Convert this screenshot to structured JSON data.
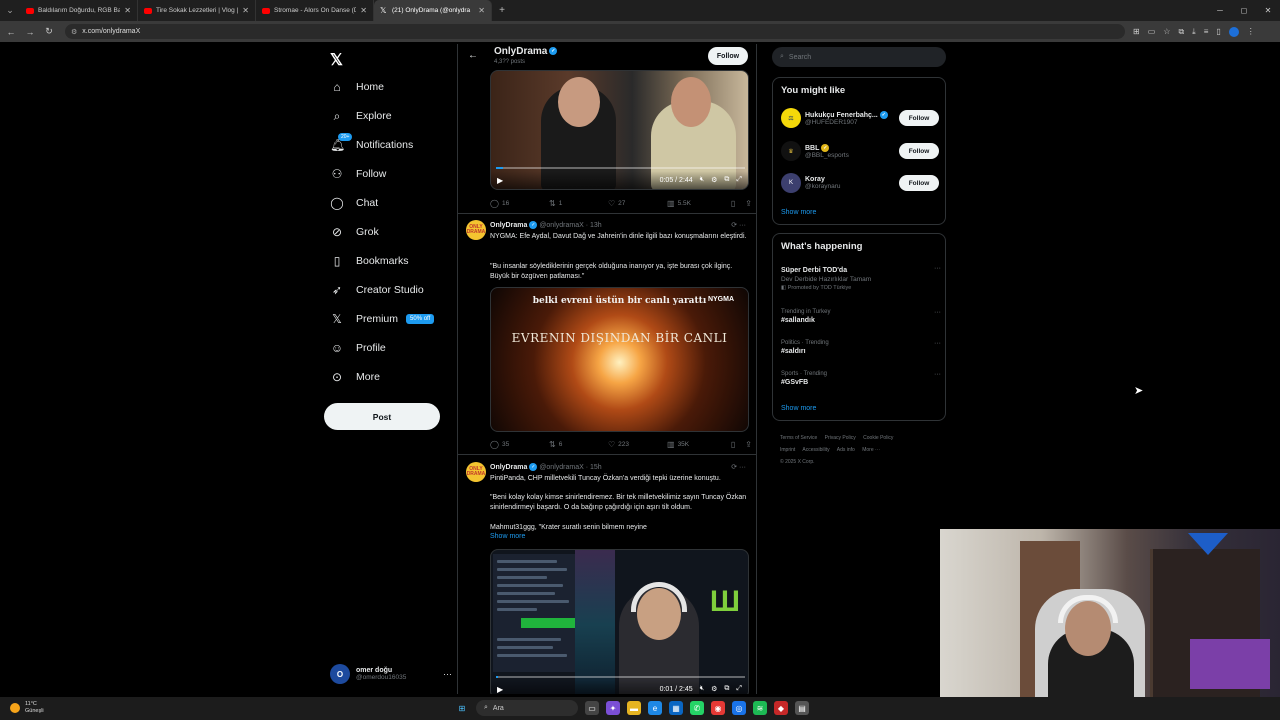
{
  "browser": {
    "tabs": [
      {
        "title": "Baldılarım Doğurdu, RGB Balkon",
        "icon": "youtube-icon",
        "active": false
      },
      {
        "title": "Tire Sokak Lezzetleri | Vlog | ",
        "icon": "youtube-icon",
        "active": false
      },
      {
        "title": "Stromae - Alors On Danse (Dul",
        "icon": "youtube-icon",
        "active": false
      },
      {
        "title": "(21) OnlyDrama (@onlydra",
        "icon": "x-icon",
        "active": true
      }
    ],
    "new_tab": "+",
    "url": "x.com/onlydramaX"
  },
  "nav": {
    "items": [
      {
        "label": "Home",
        "icon": "home-icon"
      },
      {
        "label": "Explore",
        "icon": "search-icon"
      },
      {
        "label": "Notifications",
        "icon": "bell-icon",
        "badge": "20+"
      },
      {
        "label": "Follow",
        "icon": "follow-icon"
      },
      {
        "label": "Chat",
        "icon": "chat-icon"
      },
      {
        "label": "Grok",
        "icon": "grok-icon"
      },
      {
        "label": "Bookmarks",
        "icon": "bookmark-icon"
      },
      {
        "label": "Creator Studio",
        "icon": "rocket-icon"
      },
      {
        "label": "Premium",
        "icon": "x-icon",
        "badge": "50% off"
      },
      {
        "label": "Profile",
        "icon": "user-icon"
      },
      {
        "label": "More",
        "icon": "more-circle-icon"
      }
    ],
    "post_label": "Post",
    "account": {
      "initial": "O",
      "name": "omer doğu",
      "handle": "@omerdou16035"
    }
  },
  "header": {
    "name": "OnlyDrama",
    "posts": "4,3?? posts",
    "follow_label": "Follow"
  },
  "tweets": [
    {
      "video": {
        "time": "0:05 / 2:44",
        "progress": 0.03
      },
      "stats": {
        "replies": "16",
        "reposts": "1",
        "likes": "27",
        "views": "5.5K"
      }
    },
    {
      "name": "OnlyDrama",
      "handle": "@onlydramaX",
      "time": "13h",
      "avatar_text": "ONLY DRAMA",
      "text": "NYGMA: Efe Aydal, Davut Dağ ve Jahrein'in dinle ilgili bazı konuşmalarını eleştirdi.",
      "text2": "\"Bu insanlar söylediklerinin gerçek olduğuna inanıyor ya, işte burası çok ilginç. Büyük bir özgüven patlaması.\"",
      "media": {
        "caption": "belki evreni üstün bir canlı yarattı",
        "logo": "NYGMA",
        "big": "EVRENIN DIŞINDAN BİR CANLI"
      },
      "stats": {
        "replies": "35",
        "reposts": "6",
        "likes": "223",
        "views": "35K"
      }
    },
    {
      "name": "OnlyDrama",
      "handle": "@onlydramaX",
      "time": "15h",
      "avatar_text": "ONLY DRAMA",
      "text": "PintiPanda, CHP milletvekili Tuncay Özkan'a verdiği tepki üzerine konuştu.",
      "text2": "\"Beni kolay kolay kimse sinirlendiremez. Bir tek milletvekilimiz sayın Tuncay Özkan sinirlendirmeyi başardı. O da bağırıp çağırdığı için aşırı tilt oldum.",
      "text3": "Mahmut31ggg, \"Krater suratlı senin bilmem neyine",
      "show_more": "Show more",
      "video": {
        "time": "0:01 / 2:45",
        "progress": 0.01
      }
    }
  ],
  "right": {
    "search_placeholder": "Search",
    "might_like_title": "You might like",
    "suggestions": [
      {
        "name": "Hukukçu Fenerbahç...",
        "handle": "@HUFEDER1907",
        "badge": "blue",
        "follow": "Follow"
      },
      {
        "name": "BBL",
        "handle": "@BBL_esports",
        "badge": "gold",
        "follow": "Follow"
      },
      {
        "name": "Koray",
        "handle": "@koraynaru",
        "badge": "",
        "follow": "Follow"
      }
    ],
    "show_more": "Show more",
    "happening_title": "What's happening",
    "trends": [
      {
        "meta": "",
        "title": "Süper Derbi TOD'da",
        "desc": "Dev Derbide Hazırlıklar Tamam",
        "promo": "Promoted by TOD Türkiye"
      },
      {
        "meta": "Trending in Turkey",
        "title": "#sallandık",
        "desc": "",
        "promo": ""
      },
      {
        "meta": "Politics · Trending",
        "title": "#saldırı",
        "desc": "",
        "promo": ""
      },
      {
        "meta": "Sports · Trending",
        "title": "#GSvFB",
        "desc": "",
        "promo": ""
      }
    ],
    "show_more2": "Show more",
    "footer": [
      "Terms of Service",
      "Privacy Policy",
      "Cookie Policy",
      "Imprint",
      "Accessibility",
      "Ads info",
      "More ···",
      "© 2025 X Corp."
    ]
  },
  "taskbar": {
    "weather_temp": "11°C",
    "weather_desc": "Güneşli",
    "search_label": "Ara"
  }
}
